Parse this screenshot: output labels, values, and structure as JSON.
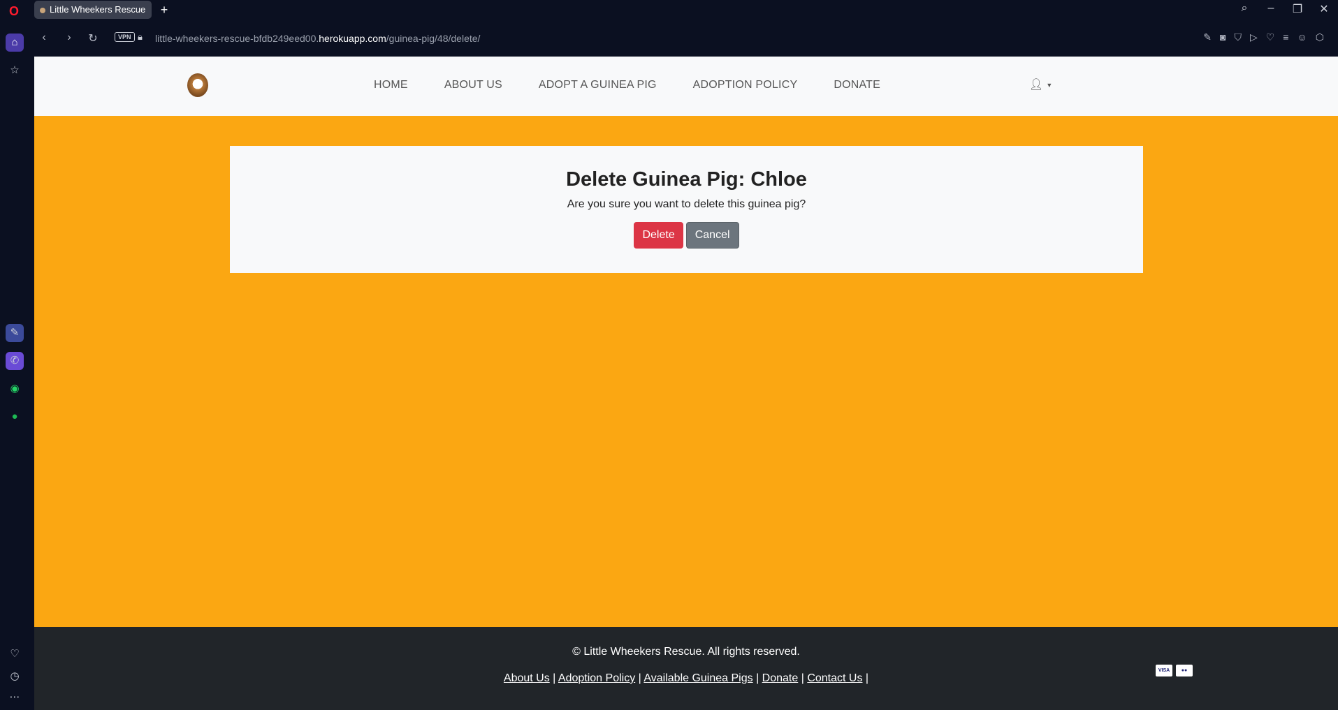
{
  "browser": {
    "tab_title": "Little Wheekers Rescue",
    "new_tab": "+",
    "vpn_label": "VPN",
    "url_prefix": "little-wheekers-rescue-bfdb249eed00.",
    "url_host": "herokuapp.com",
    "url_path": "/guinea-pig/48/delete/"
  },
  "nav": {
    "items": [
      {
        "label": "HOME"
      },
      {
        "label": "ABOUT US"
      },
      {
        "label": "ADOPT A GUINEA PIG"
      },
      {
        "label": "ADOPTION POLICY"
      },
      {
        "label": "DONATE"
      }
    ]
  },
  "dialog": {
    "title": "Delete Guinea Pig: Chloe",
    "message": "Are you sure you want to delete this guinea pig?",
    "delete_label": "Delete",
    "cancel_label": "Cancel"
  },
  "footer": {
    "copyright": "© Little Wheekers Rescue. All rights reserved.",
    "links": [
      "About Us",
      "Adoption Policy",
      "Available Guinea Pigs",
      "Donate",
      "Contact Us"
    ],
    "payment_visa": "VISA"
  },
  "colors": {
    "page_bg": "#fba712",
    "danger": "#dc3545",
    "secondary": "#6c757d",
    "footer_bg": "#212529"
  }
}
